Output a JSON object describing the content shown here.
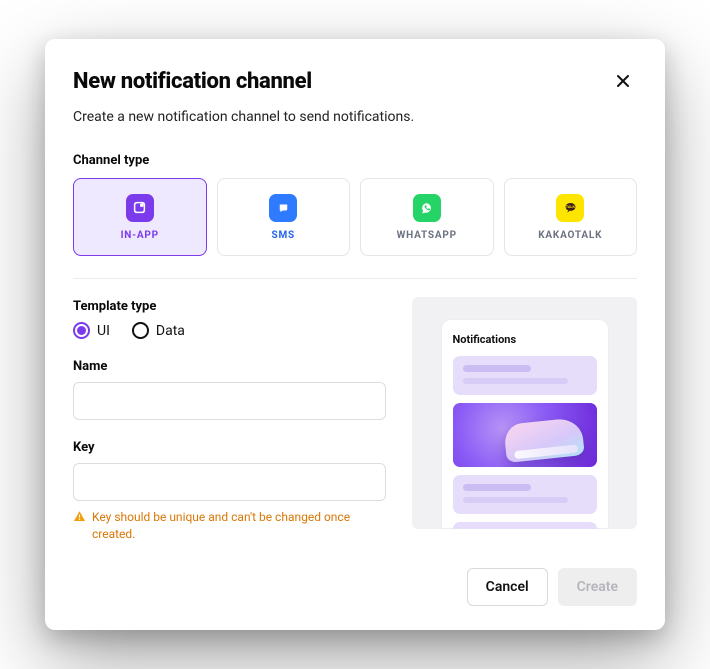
{
  "modal": {
    "title": "New notification channel",
    "description": "Create a new notification channel to send notifications."
  },
  "channel": {
    "section_label": "Channel type",
    "options": [
      {
        "label": "IN-APP",
        "selected": true
      },
      {
        "label": "SMS",
        "selected": false
      },
      {
        "label": "WHATSAPP",
        "selected": false
      },
      {
        "label": "KAKAOTALK",
        "selected": false
      }
    ]
  },
  "template": {
    "section_label": "Template type",
    "options": [
      {
        "label": "UI",
        "selected": true
      },
      {
        "label": "Data",
        "selected": false
      }
    ]
  },
  "fields": {
    "name_label": "Name",
    "name_value": "",
    "key_label": "Key",
    "key_value": "",
    "key_hint": "Key should be unique and can't be changed once created."
  },
  "preview": {
    "title": "Notifications"
  },
  "footer": {
    "cancel": "Cancel",
    "create": "Create"
  },
  "colors": {
    "accent": "#7c3aed",
    "warning": "#d97706"
  }
}
